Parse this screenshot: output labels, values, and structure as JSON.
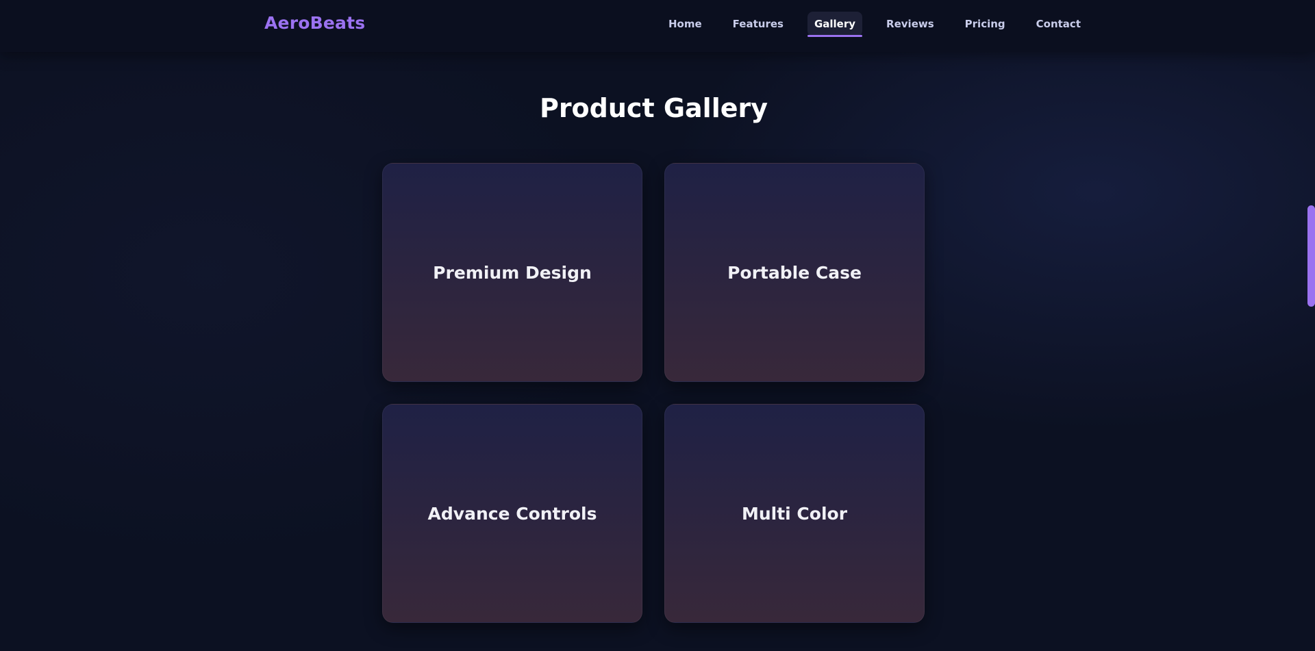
{
  "brand": {
    "name": "AeroBeats",
    "color": "#9b72f0"
  },
  "nav": {
    "items": [
      {
        "label": "Home"
      },
      {
        "label": "Features"
      },
      {
        "label": "Gallery"
      },
      {
        "label": "Reviews"
      },
      {
        "label": "Pricing"
      },
      {
        "label": "Contact"
      }
    ],
    "active": "Gallery",
    "accent_color": "#9b72f0"
  },
  "gallery": {
    "title": "Product Gallery",
    "cards": [
      {
        "label": "Premium Design"
      },
      {
        "label": "Portable Case"
      },
      {
        "label": "Advance Controls"
      },
      {
        "label": "Multi Color"
      }
    ]
  },
  "colors": {
    "background": "#0c1122",
    "card_gradient_top": "#1f2145",
    "card_gradient_bottom": "#38283a"
  }
}
